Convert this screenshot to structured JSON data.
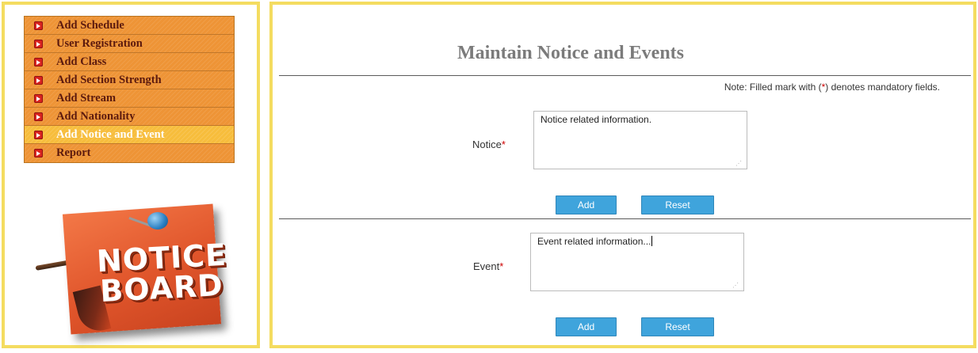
{
  "sidebar": {
    "menu": [
      {
        "label": "Add Schedule"
      },
      {
        "label": "User Registration"
      },
      {
        "label": "Add Class"
      },
      {
        "label": "Add Section Strength"
      },
      {
        "label": "Add Stream"
      },
      {
        "label": "Add Nationality"
      },
      {
        "label": "Add Notice and Event",
        "active": true
      },
      {
        "label": "Report"
      }
    ],
    "board_image": {
      "line1": "NOTICE",
      "line2": "BOARD"
    }
  },
  "main": {
    "title": "Maintain Notice and Events",
    "note_prefix": "Note: Filled mark with (",
    "note_star": "*",
    "note_suffix": ") denotes mandatory fields.",
    "notice": {
      "label": "Notice",
      "required_mark": "*",
      "value": "Notice related information.",
      "add_label": "Add",
      "reset_label": "Reset"
    },
    "event": {
      "label": "Event",
      "required_mark": "*",
      "value": "Event related information...",
      "add_label": "Add",
      "reset_label": "Reset"
    }
  },
  "colors": {
    "frame_border": "#f4dc60",
    "menu_item": "#ee9436",
    "menu_item_active": "#f7bd3c",
    "menu_text": "#5c1a0e",
    "button": "#3fa4dc",
    "required": "#cc0000"
  }
}
